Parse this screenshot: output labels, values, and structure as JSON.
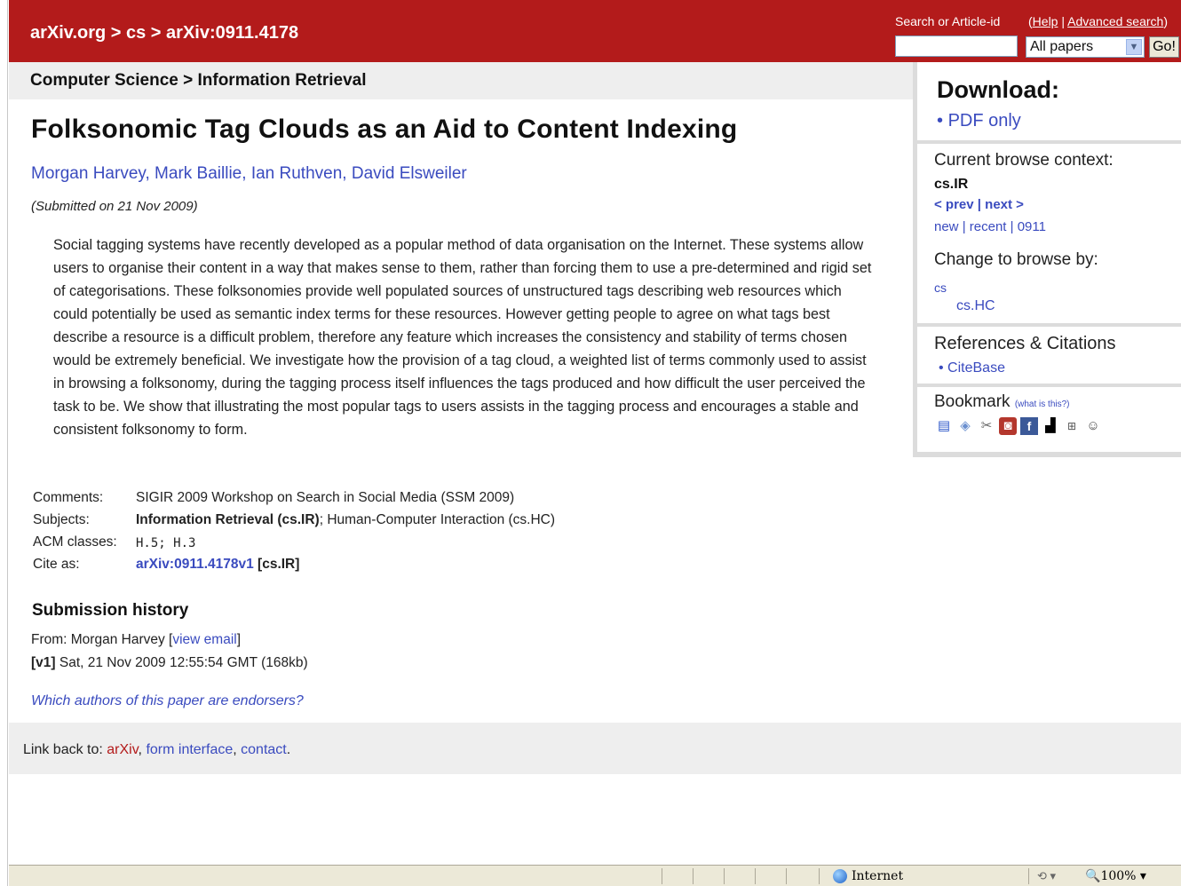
{
  "header": {
    "breadcrumb": "arXiv.org > cs > arXiv:0911.4178",
    "search_label": "Search or Article-id",
    "help_link": "Help",
    "help_separator": " | ",
    "advanced_link": "Advanced search",
    "search_value": "",
    "select_value": "All papers",
    "go_label": "Go!"
  },
  "subject_bar": "Computer Science > Information Retrieval",
  "paper": {
    "title": "Folksonomic Tag Clouds as an Aid to Content Indexing",
    "authors": [
      "Morgan Harvey",
      "Mark Baillie",
      "Ian Ruthven",
      "David Elsweiler"
    ],
    "submitted": "(Submitted on 21 Nov 2009)",
    "abstract": "Social tagging systems have recently developed as a popular method of data organisation on the Internet. These systems allow users to organise their content in a way that makes sense to them, rather than forcing them to use a pre-determined and rigid set of categorisations. These folksonomies provide well populated sources of unstructured tags describing web resources which could potentially be used as semantic index terms for these resources. However getting people to agree on what tags best describe a resource is a difficult problem, therefore any feature which increases the consistency and stability of terms chosen would be extremely beneficial. We investigate how the provision of a tag cloud, a weighted list of terms commonly used to assist in browsing a folksonomy, during the tagging process itself influences the tags produced and how difficult the user perceived the task to be. We show that illustrating the most popular tags to users assists in the tagging process and encourages a stable and consistent folksonomy to form."
  },
  "meta": {
    "comments_label": "Comments:",
    "comments_value": "SIGIR 2009 Workshop on Search in Social Media (SSM 2009)",
    "subjects_label": "Subjects:",
    "subjects_primary": "Information Retrieval (cs.IR)",
    "subjects_rest": "; Human-Computer Interaction (cs.HC)",
    "acm_label": "ACM classes:",
    "acm_value": "H.5; H.3",
    "cite_label": "Cite as:",
    "cite_link": "arXiv:0911.4178v1",
    "cite_suffix": " [cs.IR]"
  },
  "history": {
    "title": "Submission history",
    "from_prefix": "From: Morgan Harvey [",
    "view_email": "view email",
    "from_suffix": "]",
    "version_tag": "[v1]",
    "version_text": " Sat, 21 Nov 2009 12:55:54 GMT (168kb)"
  },
  "endorsers_link": "Which authors of this paper are endorsers?",
  "footer": {
    "prefix": "Link back to: ",
    "arxiv": "arXiv",
    "form": "form interface",
    "contact": "contact"
  },
  "sidebar": {
    "download_title": "Download:",
    "pdf_only": "PDF only",
    "context_title": "Current browse context:",
    "context_value": "cs.IR",
    "prev": "< prev",
    "next": "next >",
    "new": "new",
    "recent": "recent",
    "month": "0911",
    "change_title": "Change to browse by:",
    "browse_cs": "cs",
    "browse_cshc": "cs.HC",
    "refs_title": "References & Citations",
    "citebase": "CiteBase",
    "bookmark_title": "Bookmark",
    "bookmark_help": "(what is this?)",
    "bookmark_icons": [
      "citeulike-icon",
      "connotea-icon",
      "bibsonomy-icon",
      "mendeley-icon",
      "facebook-icon",
      "delicious-icon",
      "digg-icon",
      "reddit-icon"
    ]
  },
  "statusbar": {
    "zone": "Internet",
    "zoom": "100%"
  },
  "colors": {
    "arxiv_red": "#b31b1b",
    "link_blue": "#3a4bbf",
    "panel_gray": "#eeeeee"
  }
}
